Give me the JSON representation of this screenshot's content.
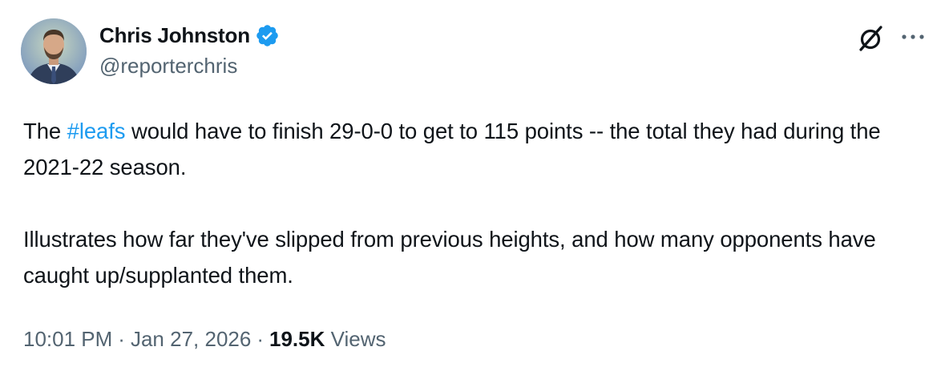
{
  "author": {
    "display_name": "Chris Johnston",
    "handle": "@reporterchris",
    "verified": true,
    "verified_color": "#1d9bf0"
  },
  "tweet": {
    "line1_before": "The ",
    "hashtag": "#leafs",
    "line1_after": " would have to finish 29-0-0 to get to 115 points -- the total they had during the 2021-22 season.",
    "paragraph2": "Illustrates how far they've slipped from previous heights, and how many opponents have caught up/supplanted them."
  },
  "meta": {
    "time": "10:01 PM",
    "separator": "·",
    "date": "Jan 27, 2026",
    "views_count": "19.5K",
    "views_label": "Views"
  },
  "icons": {
    "verified": "verified-badge-icon",
    "grok": "grok-icon",
    "more": "more-options-icon"
  },
  "colors": {
    "link": "#1d9bf0",
    "text": "#0f1419",
    "secondary": "#536471",
    "background": "#ffffff"
  }
}
